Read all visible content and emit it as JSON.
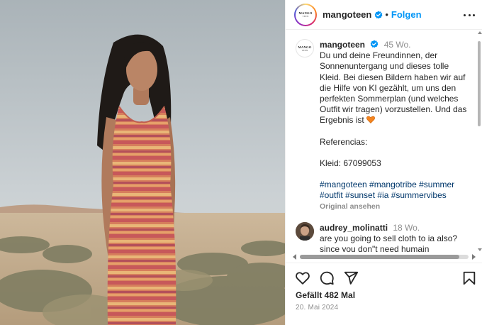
{
  "header": {
    "username": "mangoteen",
    "separator": "•",
    "follow_label": "Folgen",
    "logo_text": "MANGO",
    "logo_sub": "TEEN"
  },
  "caption": {
    "username": "mangoteen",
    "time": "45 Wo.",
    "text_main": "Du und deine Freundinnen, der Sonnenuntergang und dieses tolle Kleid. Bei diesen Bildern haben wir auf die Hilfe von KI gezählt, um uns den perfekten Sommerplan (und welches Outfit wir tragen) vorzustellen. Und das Ergebnis ist",
    "references_label": "Referencias:",
    "reference_value": "Kleid: 67099053",
    "hashtags": "#mangoteen #mangotribe #summer #outfit #sunset #ia #summervibes",
    "see_original": "Original ansehen"
  },
  "comment": {
    "username": "audrey_molinatti",
    "time": "18 Wo.",
    "text": "are you going to sell cloth to ia also? since you don\"t need humain"
  },
  "actions": {
    "icons": [
      "heart-icon",
      "comment-icon",
      "share-icon",
      "bookmark-icon"
    ]
  },
  "likes": "Gefällt 482 Mal",
  "date": "20. Mai 2024",
  "colors": {
    "accent": "#0095f6",
    "verified": "#0095f6",
    "hashtag": "#00376b",
    "muted": "#8e8e8e",
    "heart_emoji": "#f4841f"
  }
}
